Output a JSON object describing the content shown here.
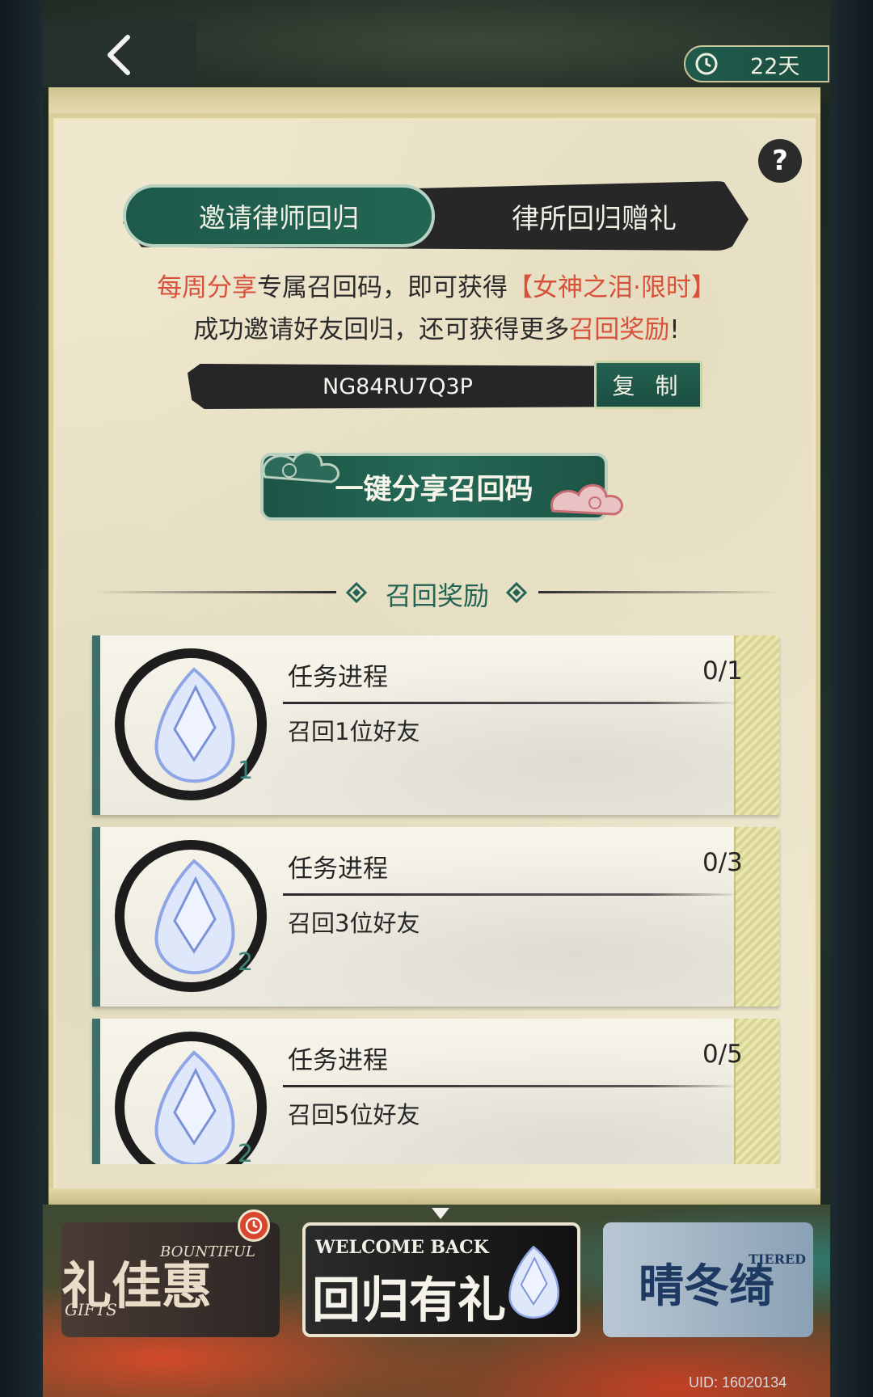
{
  "header": {
    "timer_text": "22天"
  },
  "tabs": [
    {
      "label": "邀请律师回归",
      "active": true
    },
    {
      "label": "律所回归赠礼",
      "active": false
    }
  ],
  "help": {
    "label": "?"
  },
  "description": {
    "line1_part1": "每周分享",
    "line1_part2": "专属召回码，即可获得",
    "line1_part3": "【女神之泪·限时】",
    "line2_part1": "成功邀请好友回归，还可获得更多",
    "line2_part2": "召回奖励",
    "line2_part3": "!"
  },
  "recall_code": {
    "value": "NG84RU7Q3P",
    "copy_label": "复 制"
  },
  "share_button": {
    "label": "一键分享召回码"
  },
  "rewards_section": {
    "title": "召回奖励"
  },
  "tasks": [
    {
      "title": "任务进程",
      "progress": "0/1",
      "description": "召回1位好友",
      "reward_qty": "1"
    },
    {
      "title": "任务进程",
      "progress": "0/3",
      "description": "召回3位好友",
      "reward_qty": "2"
    },
    {
      "title": "任务进程",
      "progress": "0/5",
      "description": "召回5位好友",
      "reward_qty": "2"
    }
  ],
  "banners": [
    {
      "title": "礼佳惠",
      "subtitle": "BOUNTIFUL",
      "subtitle2": "GIFTS"
    },
    {
      "title": "回归有礼",
      "subtitle": "WELCOME BACK"
    },
    {
      "title": "晴冬绮",
      "subtitle": "TIERED P"
    }
  ],
  "footer": {
    "uid": "UID: 16020134"
  },
  "colors": {
    "accent_green": "#236353",
    "highlight_red": "#d8503a",
    "paper": "#efe8cf"
  }
}
